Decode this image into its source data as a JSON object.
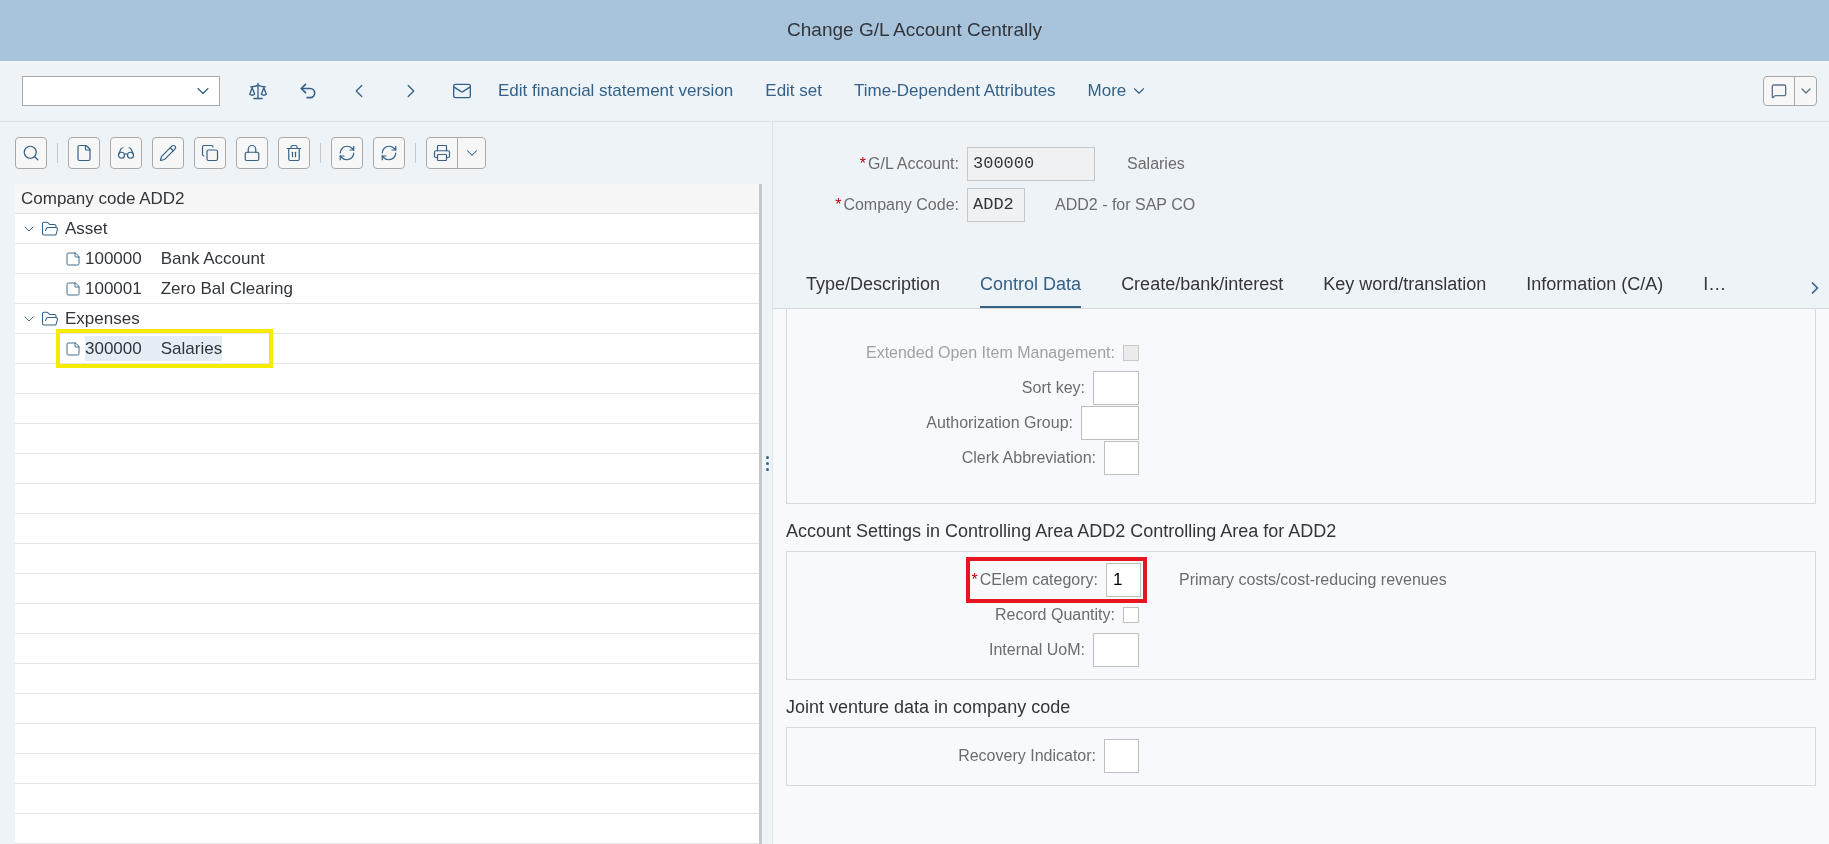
{
  "window": {
    "title": "Change G/L Account Centrally"
  },
  "toolbar": {
    "actions": [
      "Edit financial statement version",
      "Edit set",
      "Time-Dependent Attributes"
    ],
    "more": "More"
  },
  "tree": {
    "header": "Company code ADD2",
    "nodes": [
      {
        "label": "Asset",
        "expanded": true,
        "children": [
          {
            "number": "100000",
            "text": "Bank Account",
            "selected": false
          },
          {
            "number": "100001",
            "text": "Zero Bal Clearing",
            "selected": false
          }
        ]
      },
      {
        "label": "Expenses",
        "expanded": true,
        "children": [
          {
            "number": "300000",
            "text": "Salaries",
            "selected": true
          }
        ]
      }
    ]
  },
  "header_fields": [
    {
      "label": "G/L Account:",
      "required_mark": "*",
      "value": "300000",
      "description": "Salaries"
    },
    {
      "label": "Company Code:",
      "required_mark": "*",
      "value": "ADD2",
      "description": "ADD2 - for SAP CO"
    }
  ],
  "tabs": [
    {
      "label": "Type/Description",
      "selected": false
    },
    {
      "label": "Control Data",
      "selected": true
    },
    {
      "label": "Create/bank/interest",
      "selected": false
    },
    {
      "label": "Key word/translation",
      "selected": false
    },
    {
      "label": "Information (C/A)",
      "selected": false
    },
    {
      "label": "I…",
      "selected": false
    }
  ],
  "sections": [
    {
      "fields": [
        {
          "kind": "checkbox",
          "label": "Extended Open Item Management:",
          "checked": false,
          "disabled": true
        },
        {
          "kind": "input",
          "label": "Sort key:"
        },
        {
          "kind": "input",
          "label": "Authorization Group:"
        },
        {
          "kind": "input",
          "label": "Clerk Abbreviation:"
        }
      ]
    },
    {
      "heading": "Account Settings in Controlling Area ADD2 Controlling Area for ADD2",
      "fields": [
        {
          "kind": "input",
          "label": "CElem category:",
          "required_mark": "*",
          "value": "1",
          "description": "Primary costs/cost-reducing revenues"
        },
        {
          "kind": "checkbox",
          "label": "Record Quantity:",
          "checked": false,
          "disabled": false
        },
        {
          "kind": "input",
          "label": "Internal UoM:"
        }
      ]
    },
    {
      "heading": "Joint venture data in company code",
      "fields": [
        {
          "kind": "input",
          "label": "Recovery Indicator:"
        }
      ]
    }
  ]
}
